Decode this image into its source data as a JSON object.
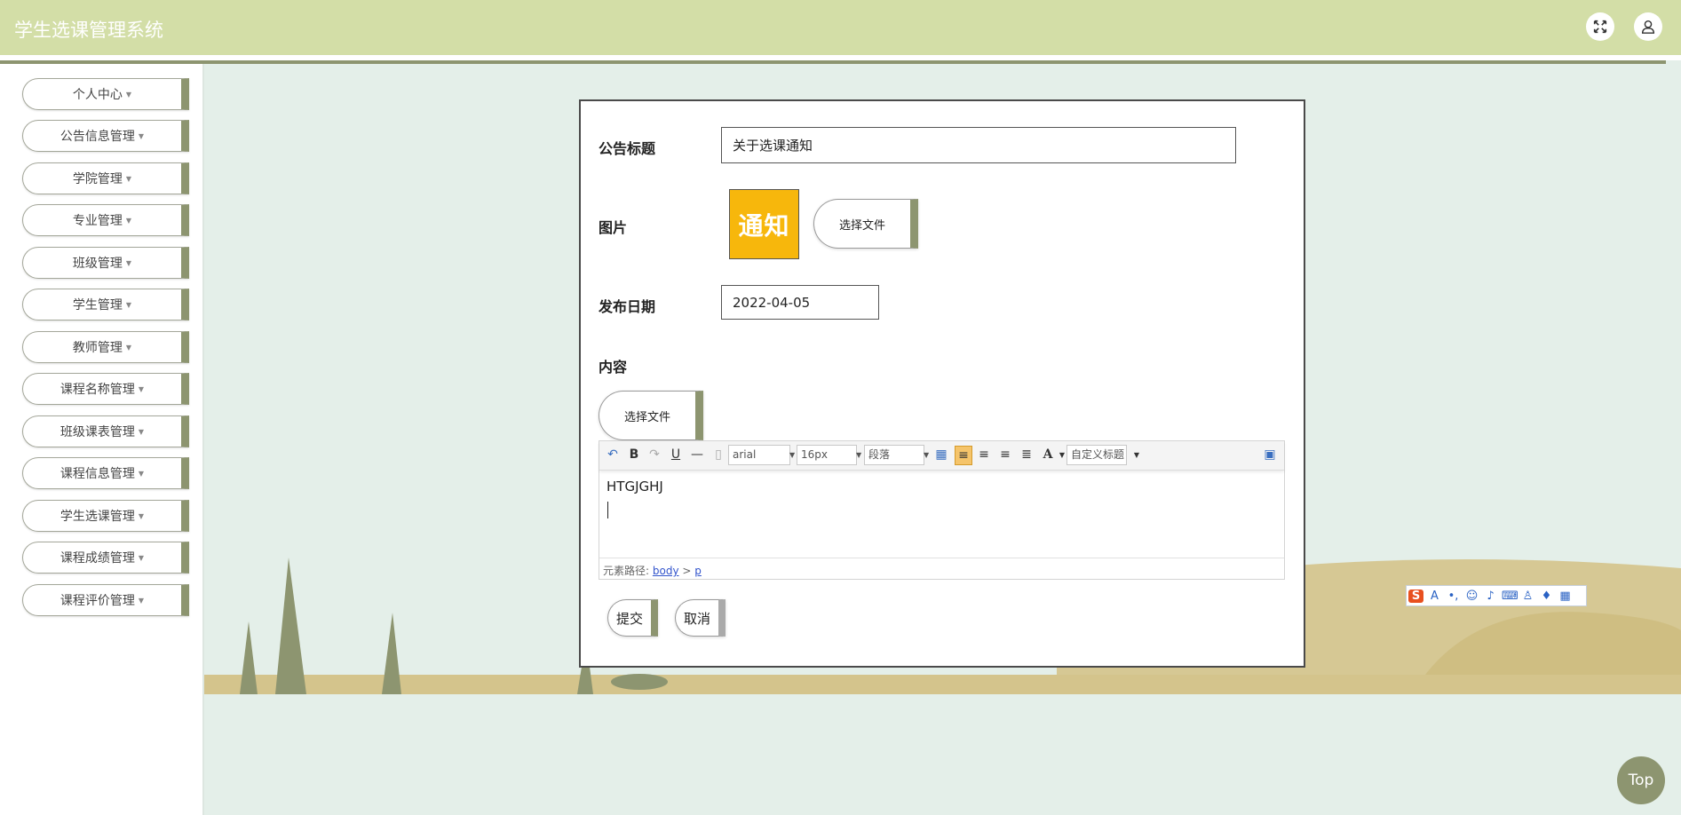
{
  "app": {
    "title": "学生选课管理系统"
  },
  "header": {
    "fullscreen_icon": "expand-icon",
    "user_icon": "user-icon"
  },
  "sidebar": {
    "items": [
      {
        "label": "个人中心"
      },
      {
        "label": "公告信息管理"
      },
      {
        "label": "学院管理"
      },
      {
        "label": "专业管理"
      },
      {
        "label": "班级管理"
      },
      {
        "label": "学生管理"
      },
      {
        "label": "教师管理"
      },
      {
        "label": "课程名称管理"
      },
      {
        "label": "班级课表管理"
      },
      {
        "label": "课程信息管理"
      },
      {
        "label": "学生选课管理"
      },
      {
        "label": "课程成绩管理"
      },
      {
        "label": "课程评价管理"
      }
    ]
  },
  "form": {
    "title_label": "公告标题",
    "title_value": "关于选课通知",
    "image_label": "图片",
    "image_text": "通知",
    "choose_file_label": "选择文件",
    "date_label": "发布日期",
    "date_value": "2022-04-05",
    "content_label": "内容",
    "content_choose_file_label": "选择文件"
  },
  "editor": {
    "font_family": "arial",
    "font_size": "16px",
    "paragraph": "段落",
    "custom_title": "自定义标题",
    "content_text": "HTGJGHJ",
    "path_label": "元素路径:",
    "path_body": "body",
    "path_sep": ">",
    "path_p": "p"
  },
  "actions": {
    "submit": "提交",
    "cancel": "取消"
  },
  "top_button": "Top",
  "colors": {
    "accent": "#8d9570",
    "header": "#d3dea7",
    "background": "#e4efe9",
    "sand": "#d4c48c"
  }
}
